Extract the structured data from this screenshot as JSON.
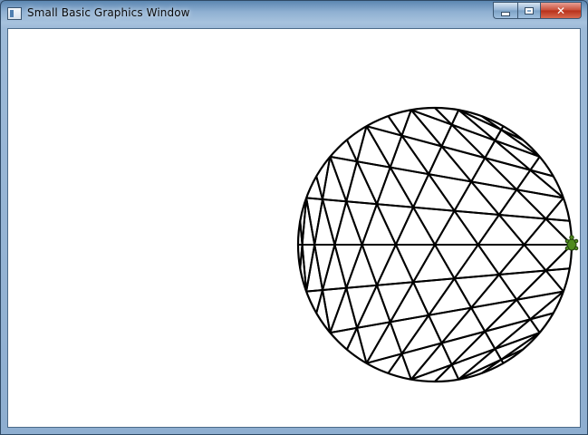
{
  "window": {
    "title": "Small Basic Graphics Window",
    "app_icon": "small-basic-window-icon",
    "controls": {
      "minimize_icon": "minimize-icon",
      "maximize_icon": "maximize-icon",
      "close_icon": "close-icon",
      "close_glyph": "✕"
    }
  },
  "canvas": {
    "background": "#ffffff",
    "drawing": "turtle string-art circle",
    "pen_color": "#000000",
    "turtle_icon": "turtle-icon",
    "turtle_color": "#4f8a1e"
  }
}
